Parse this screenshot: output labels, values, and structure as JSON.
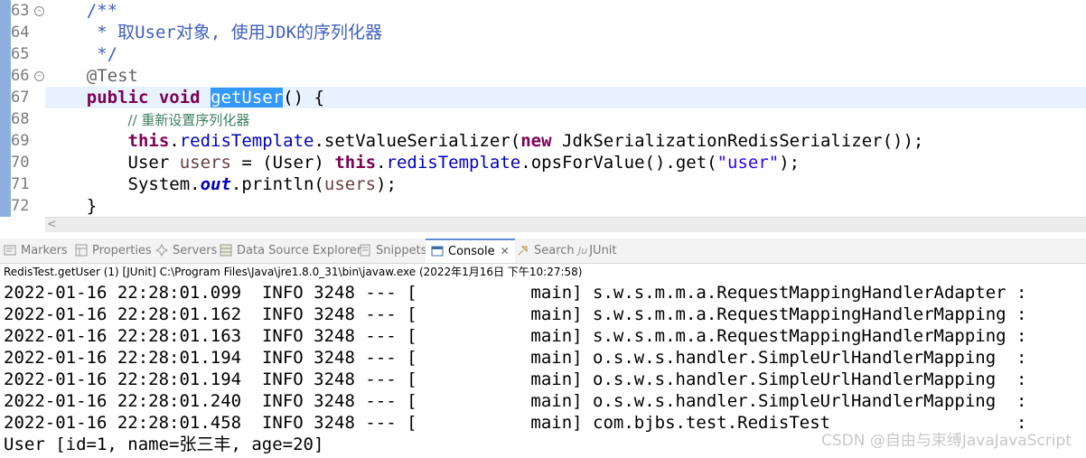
{
  "editor": {
    "line_numbers": [
      "63",
      "64",
      "65",
      "66",
      "67",
      "68",
      "69",
      "70",
      "71",
      "72"
    ],
    "lines": [
      {
        "p1": "    /**"
      },
      {
        "p1": "     * 取User对象, 使用JDK的序列化器"
      },
      {
        "p1": "     */"
      },
      {
        "p1": "    @Test"
      },
      {
        "p1": "    ",
        "p2": "public",
        "p3": " ",
        "p4": "void",
        "p5": " ",
        "p6": "getUser",
        "p7": "() {"
      },
      {
        "p1": "        ",
        "p2": "// 重新设置序列化器"
      },
      {
        "p1": "        ",
        "p2": "this",
        "p3": ".",
        "p4": "redisTemplate",
        "p5": ".setValueSerializer(",
        "p6": "new",
        "p7": " JdkSerializationRedisSerializer());"
      },
      {
        "p1": "        User ",
        "p2": "users",
        "p3": " = (User) ",
        "p4": "this",
        "p5": ".",
        "p6": "redisTemplate",
        "p7": ".opsForValue().get(",
        "p8": "\"user\"",
        "p9": ");"
      },
      {
        "p1": "        System.",
        "p2": "out",
        "p3": ".println(",
        "p4": "users",
        "p5": ");"
      },
      {
        "p1": "    }"
      }
    ],
    "scroll_left_glyph": "<"
  },
  "views": {
    "tabs": [
      {
        "label": "Markers",
        "icon": "markers-icon"
      },
      {
        "label": "Properties",
        "icon": "properties-icon"
      },
      {
        "label": "Servers",
        "icon": "servers-icon"
      },
      {
        "label": "Data Source Explorer",
        "icon": "data-source-icon"
      },
      {
        "label": "Snippets",
        "icon": "snippets-icon"
      },
      {
        "label": "Console",
        "icon": "console-icon",
        "active": true,
        "close": "✕"
      },
      {
        "label": "Search",
        "icon": "search-icon"
      },
      {
        "label": "JUnit",
        "icon": "junit-icon",
        "prefix": "Ju"
      }
    ]
  },
  "console": {
    "status": "RedisTest.getUser (1) [JUnit] C:\\Program Files\\Java\\jre1.8.0_31\\bin\\javaw.exe (2022年1月16日 下午10:27:58)",
    "lines": [
      "2022-01-16 22:28:01.099  INFO 3248 --- [           main] s.w.s.m.m.a.RequestMappingHandlerAdapter :",
      "2022-01-16 22:28:01.162  INFO 3248 --- [           main] s.w.s.m.m.a.RequestMappingHandlerMapping :",
      "2022-01-16 22:28:01.163  INFO 3248 --- [           main] s.w.s.m.m.a.RequestMappingHandlerMapping :",
      "2022-01-16 22:28:01.194  INFO 3248 --- [           main] o.s.w.s.handler.SimpleUrlHandlerMapping  :",
      "2022-01-16 22:28:01.194  INFO 3248 --- [           main] o.s.w.s.handler.SimpleUrlHandlerMapping  :",
      "2022-01-16 22:28:01.240  INFO 3248 --- [           main] o.s.w.s.handler.SimpleUrlHandlerMapping  :",
      "2022-01-16 22:28:01.458  INFO 3248 --- [           main] com.bjbs.test.RedisTest                  :",
      "User [id=1, name=张三丰, age=20]"
    ]
  },
  "watermark": "CSDN @自由与束缚JavaJavaScript",
  "colors": {
    "keyword": "#7f0055",
    "field": "#0000c0",
    "string": "#2a00ff",
    "comment": "#3f7f5f",
    "javadoc": "#3f5fbf",
    "selection": "#3399ff",
    "current_line": "#e8f2fe"
  }
}
